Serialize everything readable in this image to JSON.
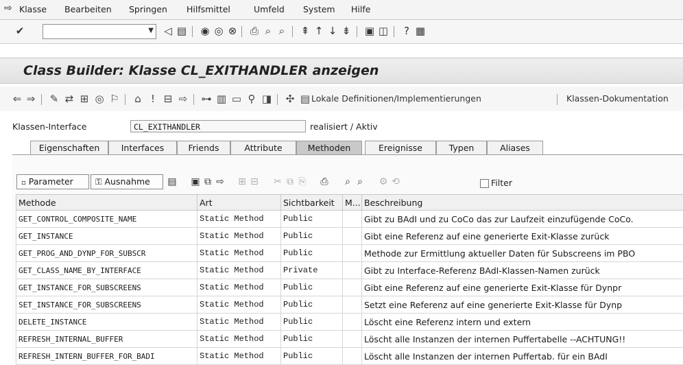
{
  "menu": {
    "items": [
      "Klasse",
      "Bearbeiten",
      "Springen",
      "Hilfsmittel",
      "Umfeld",
      "System",
      "Hilfe"
    ]
  },
  "title": "Class Builder: Klasse CL_EXITHANDLER anzeigen",
  "app_toolbar": {
    "local_definitions": "Lokale Definitionen/Implementierungen",
    "class_docs": "Klassen-Dokumentation"
  },
  "interface": {
    "label": "Klassen-Interface",
    "value": "CL_EXITHANDLER",
    "status": "realisiert / Aktiv"
  },
  "tabs": [
    "Eigenschaften",
    "Interfaces",
    "Friends",
    "Attribute",
    "Methoden",
    "Ereignisse",
    "Typen",
    "Aliases"
  ],
  "active_tab": "Methoden",
  "grid_toolbar": {
    "parameter": "Parameter",
    "exception": "Ausnahme",
    "filter": "Filter"
  },
  "table": {
    "columns": [
      "Methode",
      "Art",
      "Sichtbarkeit",
      "M...",
      "Beschreibung"
    ],
    "rows": [
      [
        "GET_CONTROL_COMPOSITE_NAME",
        "Static Method",
        "Public",
        "",
        "Gibt zu BAdI und zu CoCo das zur Laufzeit einzufügende CoCo."
      ],
      [
        "GET_INSTANCE",
        "Static Method",
        "Public",
        "",
        "Gibt eine Referenz auf eine generierte Exit-Klasse zurück"
      ],
      [
        "GET_PROG_AND_DYNP_FOR_SUBSCR",
        "Static Method",
        "Public",
        "",
        "Methode zur Ermittlung aktueller Daten für Subscreens im PBO"
      ],
      [
        "GET_CLASS_NAME_BY_INTERFACE",
        "Static Method",
        "Private",
        "",
        "Gibt zu Interface-Referenz BAdI-Klassen-Namen zurück"
      ],
      [
        "GET_INSTANCE_FOR_SUBSCREENS",
        "Static Method",
        "Public",
        "",
        "Gibt eine Referenz auf eine generierte Exit-Klasse für Dynpr"
      ],
      [
        "SET_INSTANCE_FOR_SUBSCREENS",
        "Static Method",
        "Public",
        "",
        "Setzt eine Referenz auf eine generierte Exit-Klasse für Dynp"
      ],
      [
        "DELETE_INSTANCE",
        "Static Method",
        "Public",
        "",
        "Löscht eine Referenz intern und extern"
      ],
      [
        "REFRESH_INTERNAL_BUFFER",
        "Static Method",
        "Public",
        "",
        "Löscht alle Instanzen der internen Puffertabelle --ACHTUNG!!"
      ],
      [
        "REFRESH_INTERN_BUFFER_FOR_BADI",
        "Static Method",
        "Public",
        "",
        "Löscht alle Instanzen der internen Puffertab. für ein BAdI"
      ]
    ]
  }
}
